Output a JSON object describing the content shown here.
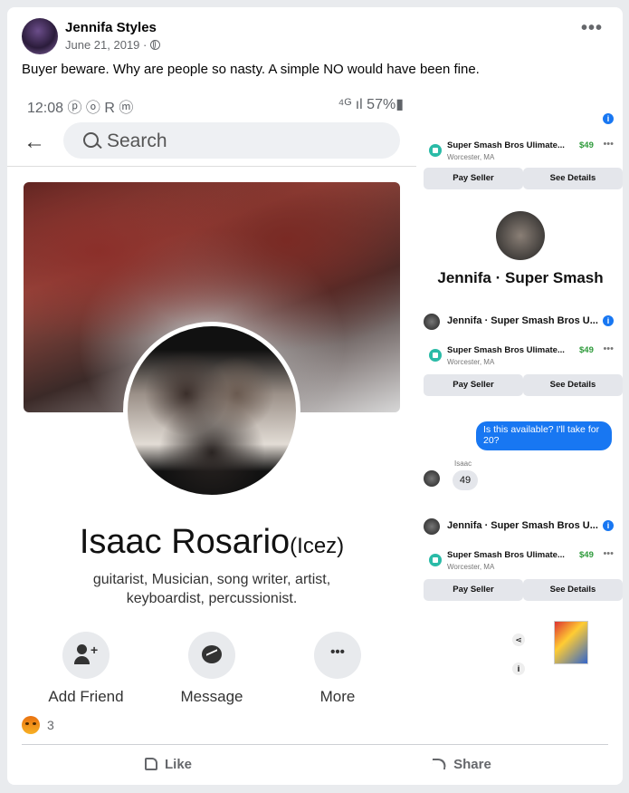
{
  "post": {
    "author": "Jennifa Styles",
    "date": "June 21, 2019 ·",
    "caption": "Buyer beware. Why are people so nasty. A simple NO would have been fine.",
    "more_icon": "•••"
  },
  "phone": {
    "status_time": "12:08 ⓟ ⓞ R ⓜ",
    "status_right": "⁴ᴳ ıl 57%▮",
    "search_placeholder": "Search",
    "profile_name": "Isaac Rosario",
    "profile_nickname": "(Icez)",
    "bio": "guitarist, Musician, song writer, artist, keyboardist, percussionist.",
    "actions": [
      {
        "label": "Add Friend",
        "icon": "add-friend-icon"
      },
      {
        "label": "Message",
        "icon": "messenger-icon"
      },
      {
        "label": "More",
        "icon": "more-icon"
      }
    ]
  },
  "marketplace": {
    "item_title": "Super Smash Bros Ulimate...",
    "price": "$49",
    "location": "Worcester, MA",
    "pay_seller": "Pay Seller",
    "see_details": "See Details",
    "thread_title": "Jennifa · Super Smash Bros U...",
    "big_title": "Jennifa · Super Smash",
    "message_out": "Is this available? I'll take for 20?",
    "sender": "Isaac",
    "reply": "49"
  },
  "footer": {
    "reaction_count": "3",
    "like_label": "Like",
    "share_label": "Share"
  }
}
